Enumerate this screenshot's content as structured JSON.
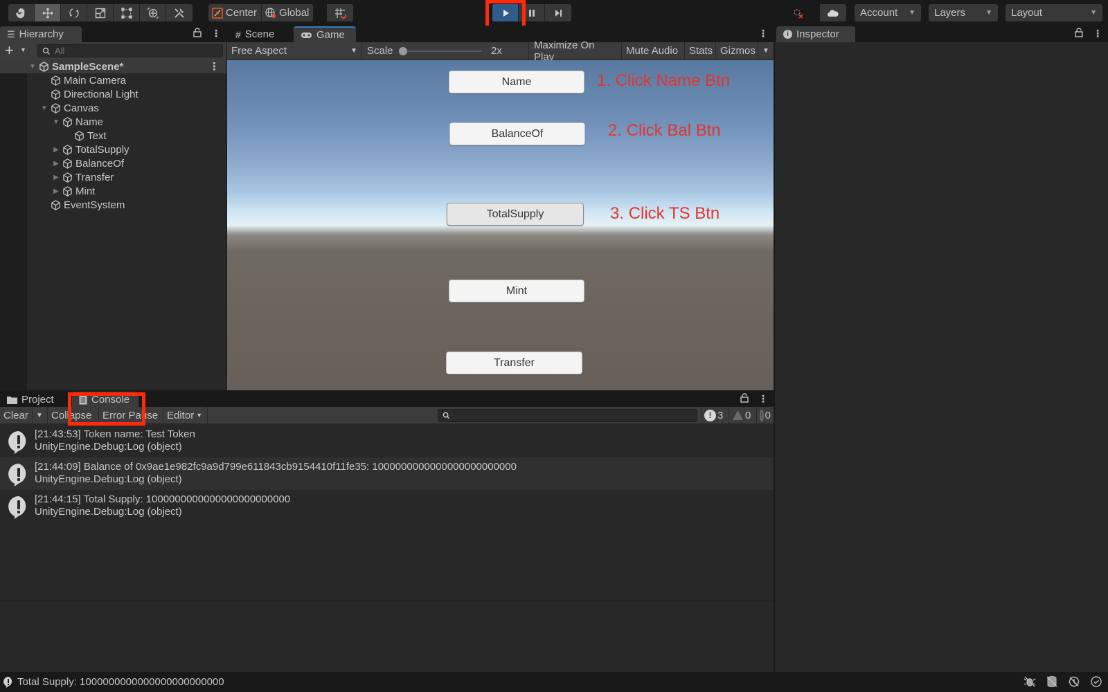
{
  "toolbar": {
    "tools": [
      {
        "name": "hand-tool",
        "icon": "hand-icon",
        "selected": false
      },
      {
        "name": "move-tool",
        "icon": "move-icon",
        "selected": true
      },
      {
        "name": "rotate-tool",
        "icon": "rotate-icon",
        "selected": false
      },
      {
        "name": "scale-tool",
        "icon": "scale-icon",
        "selected": false
      },
      {
        "name": "rect-tool",
        "icon": "rect-icon",
        "selected": false
      },
      {
        "name": "transform-tool",
        "icon": "transform-icon",
        "selected": false
      },
      {
        "name": "custom-tool",
        "icon": "tools-icon",
        "selected": false
      }
    ],
    "pivot_label": "Center",
    "space_label": "Global",
    "snap_icon": "grid-snap-icon",
    "play_icon": "play-icon",
    "pause_icon": "pause-icon",
    "step_icon": "step-icon",
    "collab_icon": "collab-icon",
    "cloud_icon": "cloud-icon",
    "account_label": "Account",
    "layers_label": "Layers",
    "layout_label": "Layout"
  },
  "hierarchy": {
    "tab_label": "Hierarchy",
    "search_placeholder": "All",
    "scene_name": "SampleScene*",
    "items": [
      {
        "label": "Main Camera",
        "depth": 1,
        "expander": "none"
      },
      {
        "label": "Directional Light",
        "depth": 1,
        "expander": "none"
      },
      {
        "label": "Canvas",
        "depth": 1,
        "expander": "expanded"
      },
      {
        "label": "Name",
        "depth": 2,
        "expander": "expanded"
      },
      {
        "label": "Text",
        "depth": 3,
        "expander": "none"
      },
      {
        "label": "TotalSupply",
        "depth": 2,
        "expander": "collapsed"
      },
      {
        "label": "BalanceOf",
        "depth": 2,
        "expander": "collapsed"
      },
      {
        "label": "Transfer",
        "depth": 2,
        "expander": "collapsed"
      },
      {
        "label": "Mint",
        "depth": 2,
        "expander": "collapsed"
      },
      {
        "label": "EventSystem",
        "depth": 1,
        "expander": "none"
      }
    ]
  },
  "game": {
    "tabs": [
      {
        "label": "Scene",
        "icon": "grid-icon",
        "active": false
      },
      {
        "label": "Game",
        "icon": "gamepad-icon",
        "active": true
      }
    ],
    "aspect_label": "Free Aspect",
    "scale_label": "Scale",
    "scale_value": "2x",
    "scale_fraction": 0.0,
    "maximize_label": "Maximize On Play",
    "mute_label": "Mute Audio",
    "stats_label": "Stats",
    "gizmos_label": "Gizmos",
    "buttons": {
      "name": "Name",
      "balance": "BalanceOf",
      "total_supply": "TotalSupply",
      "mint": "Mint",
      "transfer": "Transfer"
    },
    "annotations": {
      "step1": "1. Click Name Btn",
      "step2": "2. Click Bal Btn",
      "step3": "3. Click TS Btn"
    }
  },
  "inspector": {
    "tab_label": "Inspector"
  },
  "console": {
    "tabs": [
      {
        "label": "Project",
        "icon": "folder-icon"
      },
      {
        "label": "Console",
        "icon": "console-icon"
      }
    ],
    "clear_label": "Clear",
    "collapse_label": "Collapse",
    "error_pause_label": "Error Pause",
    "editor_label": "Editor",
    "search_value": "",
    "log_count": "3",
    "warning_count": "0",
    "error_count": "0",
    "entries": [
      {
        "message": "[21:43:53] Token name: Test Token",
        "trace": "UnityEngine.Debug:Log (object)"
      },
      {
        "message": "[21:44:09] Balance of 0x9ae1e982fc9a9d799e611843cb9154410f11fe35: 1000000000000000000000000",
        "trace": "UnityEngine.Debug:Log (object)"
      },
      {
        "message": "[21:44:15] Total Supply: 1000000000000000000000000",
        "trace": "UnityEngine.Debug:Log (object)"
      }
    ]
  },
  "statusbar": {
    "message": "Total Supply: 1000000000000000000000000",
    "icons": [
      "debug-off-icon",
      "cache-off-icon",
      "auto-generate-off-icon",
      "check-circle-icon"
    ]
  },
  "colors": {
    "highlight": "#ff2a0a",
    "annotation": "#e3342f",
    "play_active": "#2f5c8a",
    "accent_tab": "#3a79bb"
  }
}
